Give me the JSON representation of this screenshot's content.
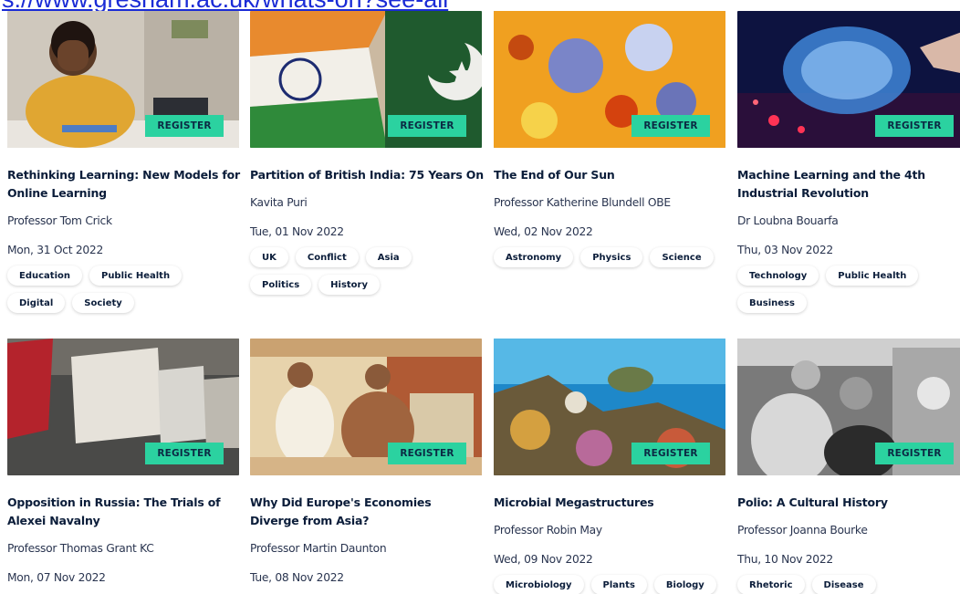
{
  "url_text": "s://www.gresham.ac.uk/whats-on?see-all",
  "register_label": "REGISTER",
  "cards": [
    {
      "title": "Rethinking Learning: New Models for Online Learning",
      "speaker": "Professor Tom Crick",
      "date": "Mon, 31 Oct 2022",
      "tags": [
        "Education",
        "Public Health",
        "Digital",
        "Society"
      ]
    },
    {
      "title": "Partition of British India: 75 Years On",
      "speaker": "Kavita Puri",
      "date": "Tue, 01 Nov 2022",
      "tags": [
        "UK",
        "Conflict",
        "Asia",
        "Politics",
        "History"
      ]
    },
    {
      "title": "The End of Our Sun",
      "speaker": "Professor Katherine Blundell OBE",
      "date": "Wed, 02 Nov 2022",
      "tags": [
        "Astronomy",
        "Physics",
        "Science"
      ]
    },
    {
      "title": "Machine Learning and the 4th Industrial Revolution",
      "speaker": "Dr Loubna Bouarfa",
      "date": "Thu, 03 Nov 2022",
      "tags": [
        "Technology",
        "Public Health",
        "Business"
      ]
    },
    {
      "title": "Opposition in Russia: The Trials of Alexei Navalny",
      "speaker": "Professor Thomas Grant KC",
      "date": "Mon, 07 Nov 2022",
      "tags": []
    },
    {
      "title": "Why Did Europe's Economies Diverge from Asia?",
      "speaker": "Professor Martin Daunton",
      "date": "Tue, 08 Nov 2022",
      "tags": []
    },
    {
      "title": "Microbial Megastructures",
      "speaker": "Professor Robin May",
      "date": "Wed, 09 Nov 2022",
      "tags": [
        "Microbiology",
        "Plants",
        "Biology"
      ]
    },
    {
      "title": "Polio: A Cultural History",
      "speaker": "Professor Joanna Bourke",
      "date": "Thu, 10 Nov 2022",
      "tags": [
        "Rhetoric",
        "Disease"
      ]
    }
  ],
  "colors": {
    "accent": "#2bd2a0",
    "text": "#0b1d3a",
    "link": "#1a2bd6"
  }
}
